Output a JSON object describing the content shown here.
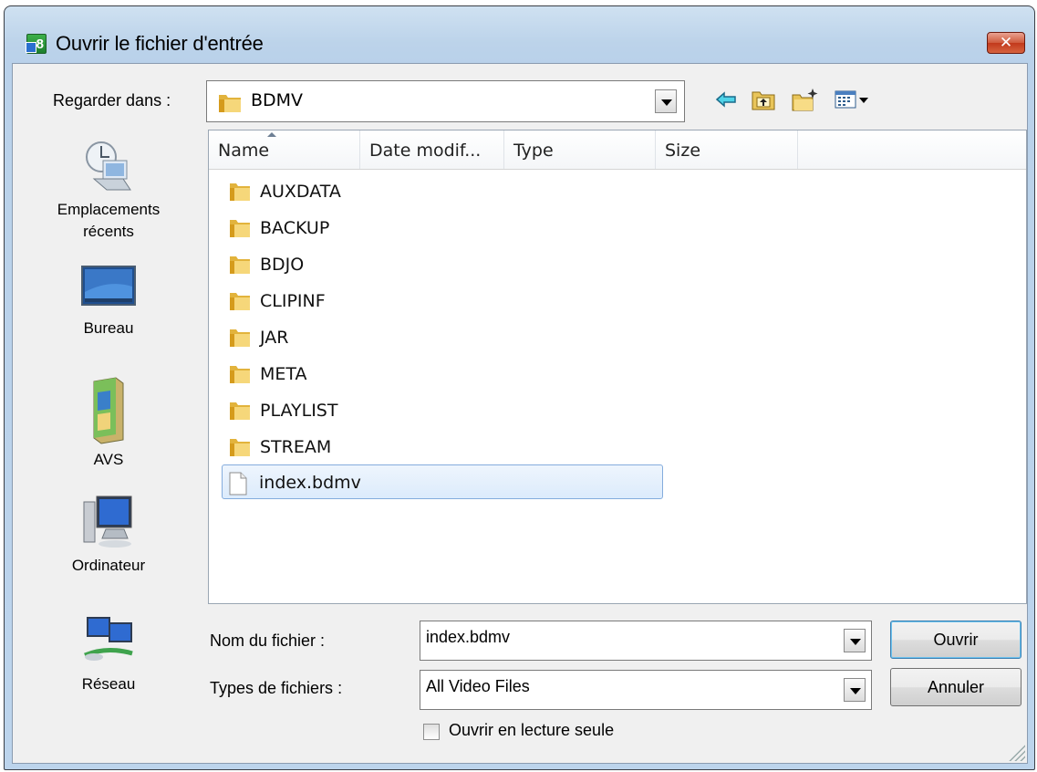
{
  "window": {
    "title": "Ouvrir le fichier d'entrée",
    "close_glyph": "✕"
  },
  "look_in": {
    "label": "Regarder dans :",
    "value": "BDMV"
  },
  "toolbar": {
    "icons": [
      "back-arrow-icon",
      "up-folder-icon",
      "new-folder-icon",
      "view-menu-icon"
    ]
  },
  "places": [
    {
      "label": "Emplacements récents",
      "icon": "recent-places-icon"
    },
    {
      "label": "Bureau",
      "icon": "desktop-icon"
    },
    {
      "label": "AVS",
      "icon": "avs-folder-icon"
    },
    {
      "label": "Ordinateur",
      "icon": "computer-icon"
    },
    {
      "label": "Réseau",
      "icon": "network-icon"
    }
  ],
  "file_list": {
    "columns": [
      "Name",
      "Date modif...",
      "Type",
      "Size"
    ],
    "items": [
      {
        "name": "AUXDATA",
        "kind": "folder"
      },
      {
        "name": "BACKUP",
        "kind": "folder"
      },
      {
        "name": "BDJO",
        "kind": "folder"
      },
      {
        "name": "CLIPINF",
        "kind": "folder"
      },
      {
        "name": "JAR",
        "kind": "folder"
      },
      {
        "name": "META",
        "kind": "folder"
      },
      {
        "name": "PLAYLIST",
        "kind": "folder"
      },
      {
        "name": "STREAM",
        "kind": "folder"
      },
      {
        "name": "index.bdmv",
        "kind": "file",
        "selected": true
      }
    ]
  },
  "filename": {
    "label": "Nom du fichier :",
    "value": "index.bdmv"
  },
  "filetype": {
    "label": "Types de fichiers :",
    "value": "All Video Files"
  },
  "buttons": {
    "open": "Ouvrir",
    "cancel": "Annuler"
  },
  "readonly_checkbox": {
    "label": "Ouvrir en lecture seule",
    "checked": false
  }
}
